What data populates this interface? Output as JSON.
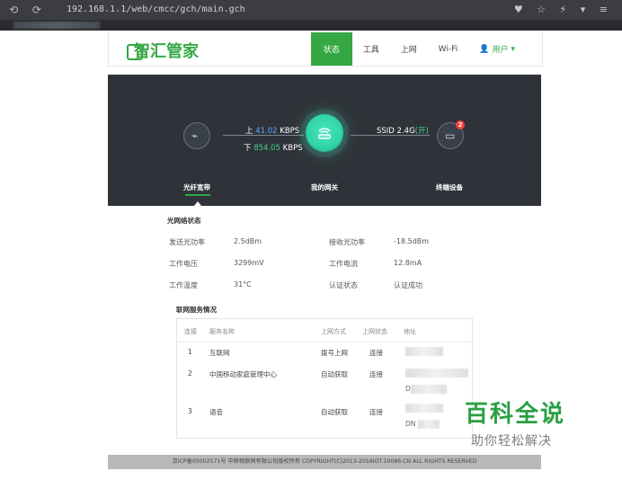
{
  "browser": {
    "url": "192.168.1.1/web/cmcc/gch/main.gch",
    "nav_glyphs": "⟲ ⟳",
    "right_glyphs": "♥ ☆ ⚡ ▾ ≡"
  },
  "brand": {
    "logo_text": "智汇管家"
  },
  "menu": {
    "status": "状态",
    "tools": "工具",
    "internet": "上网",
    "wifi": "Wi-Fi",
    "user": "用户",
    "user_icon": "user-icon",
    "dropdown_icon": "chevron-down-icon"
  },
  "status_panel": {
    "upload_prefix": "上",
    "upload_value": "41.02",
    "upload_unit": "KBPS",
    "download_prefix": "下",
    "download_value": "854.05",
    "download_unit": "KBPS",
    "ssid_text": "SSID 2.4G",
    "ssid_state": "(开)",
    "badge_count": "2",
    "fiber_label": "光纤宽带",
    "gateway_label": "我的网关",
    "terminal_label": "终端设备",
    "colors": {
      "accent": "#35a843",
      "upload": "#5aa8ff",
      "download": "#42d18a",
      "badge": "#ff3d3d"
    }
  },
  "optical": {
    "title": "光网络状态",
    "rows": [
      {
        "label": "发送光功率",
        "value": "2.5dBm",
        "label2": "接收光功率",
        "value2": "-18.5dBm"
      },
      {
        "label": "工作电压",
        "value": "3299mV",
        "label2": "工作电流",
        "value2": "12.8mA"
      },
      {
        "label": "工作温度",
        "value": "31°C",
        "label2": "认证状态",
        "value2": "认证成功"
      }
    ]
  },
  "services": {
    "title": "联网服务情况",
    "headers": [
      "连接",
      "服务名称",
      "上网方式",
      "上网状态",
      "地址"
    ],
    "rows": [
      {
        "id": "1",
        "name": "互联网",
        "method": "拨号上网",
        "status": "连接"
      },
      {
        "id": "2",
        "name": "中国移动家庭管理中心",
        "method": "自动获取",
        "status": "连接"
      },
      {
        "id": "3",
        "name": "语音",
        "method": "自动获取",
        "status": "连接"
      }
    ],
    "partial_text": [
      "D",
      "DN"
    ]
  },
  "footer": {
    "text": "京ICP备05002571号 中移物联网有限公司版权所有 COPYRIGHT(C)2013-2016IOT.10086.CN ALL RIGHTS RESERVED"
  },
  "watermark": {
    "title": "百科全说",
    "subtitle": "助你轻松解决"
  }
}
